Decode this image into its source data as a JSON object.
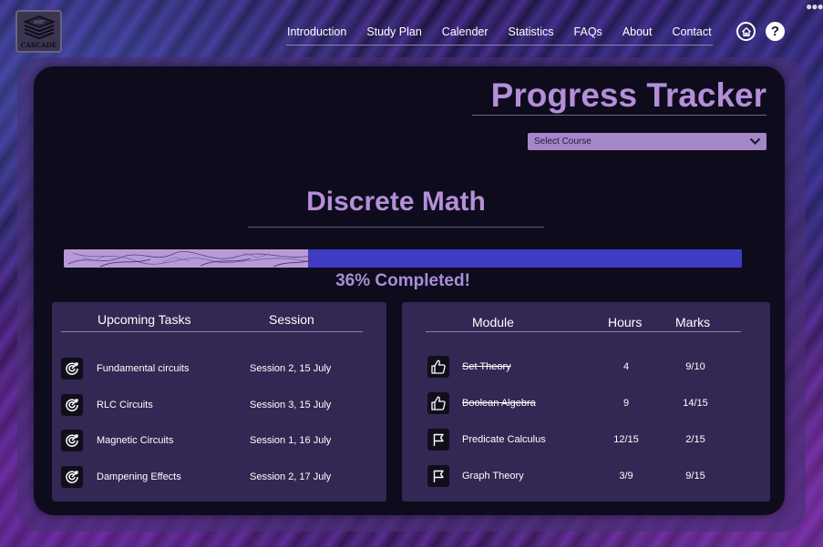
{
  "brand": {
    "logo_text": "CASCADE"
  },
  "nav": {
    "items": [
      "Introduction",
      "Study Plan",
      "Calender",
      "Statistics",
      "FAQs",
      "About",
      "Contact"
    ],
    "help_label": "?"
  },
  "icons": {
    "logo": "stacked-books-icon",
    "home": "home-icon",
    "help": "help-icon",
    "more": "more-dots-icon",
    "select": "chevron-down-icon",
    "task": "target-icon",
    "module_done": "thumbs-up-icon",
    "module_pending": "flag-icon"
  },
  "header": {
    "title": "Progress Tracker"
  },
  "course_select": {
    "placeholder": "Select Course"
  },
  "course": {
    "name": "Discrete Math"
  },
  "progress": {
    "percent": 36,
    "label": "36% Completed!"
  },
  "tasks": {
    "headers": [
      "Upcoming Tasks",
      "Session"
    ],
    "rows": [
      {
        "task": "Fundamental circuits",
        "session": "Session 2, 15 July"
      },
      {
        "task": "RLC Circuits",
        "session": "Session 3, 15 July"
      },
      {
        "task": "Magnetic Circuits",
        "session": "Session 1, 16 July"
      },
      {
        "task": "Dampening Effects",
        "session": "Session 2, 17 July"
      }
    ]
  },
  "modules": {
    "headers": [
      "Module",
      "Hours",
      "Marks"
    ],
    "rows": [
      {
        "module": "Set Theory",
        "hours": "4",
        "marks": "9/10",
        "completed": true
      },
      {
        "module": "Boolean Algebra",
        "hours": "9",
        "marks": "14/15",
        "completed": true
      },
      {
        "module": "Predicate Calculus",
        "hours": "12/15",
        "marks": "2/15",
        "completed": false
      },
      {
        "module": "Graph Theory",
        "hours": "3/9",
        "marks": "9/15",
        "completed": false
      }
    ]
  },
  "colors": {
    "accent_purple": "#b48fd8",
    "progress_fill": "#b99ad8",
    "progress_track": "#3e3cc4",
    "panel": "#0e0b1d",
    "card": "#332753"
  }
}
